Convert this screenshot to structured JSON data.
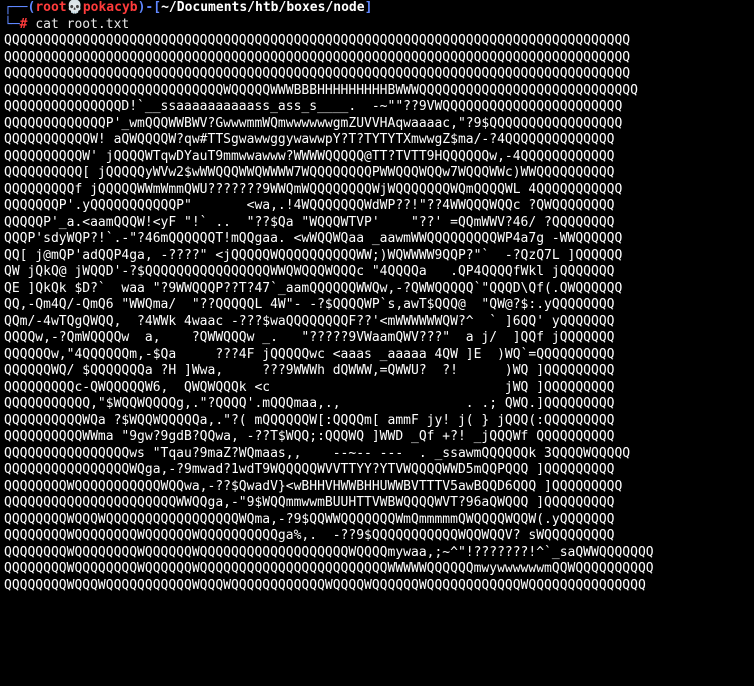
{
  "prompt": {
    "corner_top": "┌──(",
    "user": "root",
    "skull": "💀",
    "host": "pokacyb",
    "sep_mid": ")-[",
    "path": "~/Documents/htb/boxes/node",
    "bracket_close": "]",
    "corner_bottom": "└─",
    "symbol": "#",
    "command": "cat root.txt"
  },
  "output_lines": [
    "QQQQQQQQQQQQQQQQQQQQQQQQQQQQQQQQQQQQQQQQQQQQQQQQQQQQQQQQQQQQQQQQQQQQQQQQQQQQQQQQ",
    "QQQQQQQQQQQQQQQQQQQQQQQQQQQQQQQQQQQQQQQQQQQQQQQQQQQQQQQQQQQQQQQQQQQQQQQQQQQQQQQQ",
    "QQQQQQQQQQQQQQQQQQQQQQQQQQQQQQQQQQQQQQQQQQQQQQQQQQQQQQQQQQQQQQQQQQQQQQQQQQQQQQQQ",
    "QQQQQQQQQQQQQQQQQQQQQQQQQQQQWQQQQQWWWBBBHHHHHHHHHBWWWQQQQQQQQQQQQQQQQQQQQQQQQQQQQ",
    "QQQQQQQQQQQQQQQD!`__ssaaaaaaaaaass_ass_s____.  -~\"\"??9VWQQQQQQQQQQQQQQQQQQQQQQQ",
    "QQQQQQQQQQQQQP'_wmQQQWWBWV?GwwwmmWQmwwwwwwgmZUVVHAqwaaaac,\"?9$QQQQQQQQQQQQQQQQQ",
    "QQQQQQQQQQQW! aQWQQQQW?qw#TTSgwawwggywawwpY?T?TYTYTXmwwgZ$ma/-?4QQQQQQQQQQQQQQ",
    "QQQQQQQQQQW' jQQQQWTqwDYauT9mmwwawww?WWWWQQQQQ@TT?TVTT9HQQQQQQw,-4QQQQQQQQQQQQ",
    "QQQQQQQQQQ[ jQQQQQyWVw2$wWWQQQWWQWWWW7WQQQQQQQQPWWQQQWQQw7WQQQWWc)WWQQQQQQQQQQ",
    "QQQQQQQQQf jQQQQQWWmWmmQWU???????9WWQmWQQQQQQQQWjWQQQQQQQWQmQQQQWL 4QQQQQQQQQQQ",
    "QQQQQQQP'.yQQQQQQQQQQQP\"       <wa,.!4WQQQQQQQWdWP??!\"??4WWQQQWQQc ?QWQQQQQQQQ",
    "QQQQQP'_a.<aamQQQW!<yF \"!` ..  \"??$Qa \"WQQQWTVP'    \"??' =QQmWWV?46/ ?QQQQQQQQ",
    "QQQP'sdyWQP?!`.-\"?46mQQQQQQT!mQQgaa. <wWQQWQaa _aawmWWQQQQQQQQQWP4a7g -WWQQQQQQ",
    "QQ[ j@mQP'adQQP4ga, -????\" <jQQQQQWQQQQQQQQQQWW;)WQWWWW9QQP?\"`  -?QzQ7L ]QQQQQQ",
    "QW jQkQ@ jWQQD'-?$QQQQQQQQQQQQQQQQWWQWQQQWQQQc \"4QQQQa   .QP4QQQQfWkl jQQQQQQQ",
    "QE ]QkQk $D?`  waa \"?9WWQQQP??T?47`_aamQQQQQQWWQw,-?QWWQQQQQ`\"QQQD\\Qf(.QWQQQQQQ",
    "QQ,-Qm4Q/-QmQ6 \"WWQma/  \"??QQQQQL 4W\"- -?$QQQQWP`s,awT$QQQ@  \"QW@?$:.yQQQQQQQQ",
    "QQm/-4wTQgQWQQ,  ?4WWk 4waac -???$waQQQQQQQQF??'<mWWWWWWQW?^  ` ]6QQ' yQQQQQQQ",
    "QQQQw,-?QmWQQQQw  a,    ?QWWQQQw _.   \"?????9VWaamQWV???\"  a j/  ]QQf jQQQQQQQ",
    "QQQQQQw,\"4QQQQQQm,-$Qa     ???4F jQQQQQwc <aaas _aaaaa 4QW ]E  )WQ`=QQQQQQQQQQ",
    "QQQQQQWQ/ $QQQQQQQa ?H ]Wwa,     ???9WWWh dQWWW,=QWWU?  ?!      )WQ ]QQQQQQQQQ",
    "QQQQQQQQQc-QWQQQQQW6,  QWQWQQQk <c                              jWQ ]QQQQQQQQQ",
    "QQQQQQQQQQQ,\"$WQQWQQQQg,.\"?QQQQ'.mQQQmaa,.,                . .; QWQ.]QQQQQQQQQ",
    "QQQQQQQQQQWQa ?$WQQWQQQQQa,.\"?( mQQQQQQW[:QQQQm[ ammF jy! j( } jQQQ(:QQQQQQQQQ",
    "QQQQQQQQQQWWma \"9gw?9gdB?QQwa, -??T$WQQ;:QQQWQ ]WWD _Qf +?! _jQQQWf QQQQQQQQQQ",
    "QQQQQQQQQQQQQQQQws \"Tqau?9maZ?WQmaas,,    --~-- ---  . _ssawmQQQQQQk 3QQQQWQQQQQ",
    "QQQQQQQQQQQQQQQQWQga,-?9mwad?1wdT9WQQQQQWVVTTYY?YTVWQQQQWWD5mQQPQQQ ]QQQQQQQQQ",
    "QQQQQQQQWQQQQQQQQQQQWQQwa,-??$QwadV}<wBHHVHWWBHHUWWBVTTTV5awBQQD6QQQ ]QQQQQQQQQ",
    "QQQQQQQQQQQQQQQQQQQQQQWWQQga,-\"9$WQQmmwwmBUUHTTVWBWQQQQWVT?96aQWQQQ ]QQQQQQQQQ",
    "QQQQQQQQWQQQWQQQQQQQQQQQQQQQQQWQma,-?9$QQWWQQQQQQQWmQmmmmmQWQQQQWQQW(.yQQQQQQQ",
    "QQQQQQQQWQQQQQQQQWQQQQQQWQQQQQQQQQQga%,.  -??9$QQQQQQQQQQQWQQWQQV? sWQQQQQQQQQ",
    "QQQQQQQQWQQQQQQQQWQQQQQQWQQQQQQQQQQQQQQQQQQQWQQQQmywaa,;~^\"!???????!^`_saQWWQQQQQQQ",
    "QQQQQQQQWQQQQQQQQWQQQQQQWQQQQQQQQQQQQQQQQQQQQQQQQWWWWWQQQQQQmwywwwwwwmQQWQQQQQQQQQQ",
    "QQQQQQQQWQQQWQQQQQQQQQQQWQQQWQQQQQQQQQQQQWQQQQWQQQQQQWQQQQQQQQQQQQWQQQQQQQQQQQQQQQ"
  ]
}
